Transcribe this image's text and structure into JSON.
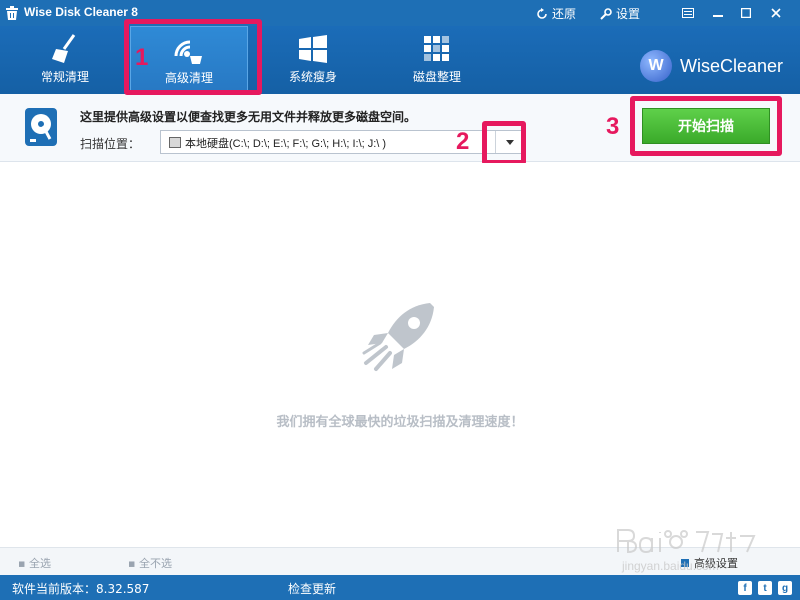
{
  "window": {
    "title": "Wise Disk Cleaner 8",
    "restore_label": "还原",
    "settings_label": "设置"
  },
  "nav": {
    "tabs": [
      {
        "label": "常规清理",
        "icon": "broom-icon"
      },
      {
        "label": "高级清理",
        "icon": "advanced-clean-icon",
        "active": true
      },
      {
        "label": "系统瘦身",
        "icon": "windows-icon"
      },
      {
        "label": "磁盘整理",
        "icon": "defrag-icon"
      }
    ],
    "brand": {
      "logo_letter": "W",
      "name": "WiseCleaner"
    }
  },
  "options": {
    "description": "这里提供高级设置以便查找更多无用文件并释放更多磁盘空间。",
    "scan_label": "扫描位置：",
    "scan_value": "本地硬盘(C:\\; D:\\; E:\\; F:\\; G:\\; H:\\; I:\\; J:\\ )",
    "start_button": "开始扫描"
  },
  "annotations": {
    "num1": "1",
    "num2": "2",
    "num3": "3",
    "color": "#e6195e"
  },
  "content": {
    "empty_message": "我们拥有全球最快的垃圾扫描及清理速度！"
  },
  "selection": {
    "select_all": "全选",
    "select_none": "全不选",
    "advanced_settings": "高级设置"
  },
  "status": {
    "version": "软件当前版本：8.32.587",
    "check_update": "检查更新"
  },
  "social": [
    "f",
    "t",
    "g"
  ],
  "colors": {
    "titlebar": "#1e6fb5",
    "accent_green": "#3aaa2a"
  }
}
